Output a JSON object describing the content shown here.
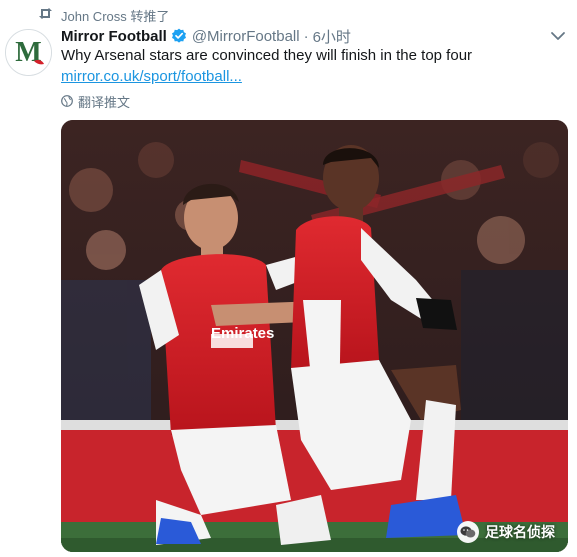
{
  "retweet": {
    "label": "John Cross 转推了",
    "icon": "retweet-icon"
  },
  "tweet": {
    "author_name": "Mirror Football",
    "verified": true,
    "handle": "@MirrorFootball",
    "separator": "·",
    "time": "6小时",
    "text": "Why Arsenal stars are convinced they will finish in the top four",
    "link": "mirror.co.uk/sport/football...",
    "translate_label": "翻译推文",
    "avatar_letter": "M"
  },
  "media": {
    "player_shirt_sponsor": "Emirates",
    "description_icon": "photo-image"
  },
  "watermark": {
    "label": "足球名侦探",
    "icon": "wechat-icon"
  },
  "colors": {
    "name": "#14171a",
    "secondary": "#657786",
    "link": "#1b95e0",
    "verified": "#1da1f2",
    "arsenal_red": "#d4202a",
    "avatar_green": "#2e6b3c"
  }
}
